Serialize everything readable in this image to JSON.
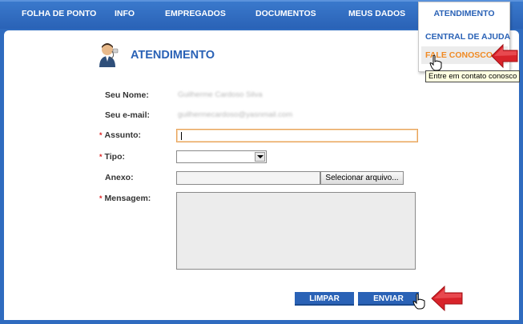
{
  "nav": {
    "items": [
      {
        "label": "FOLHA DE PONTO"
      },
      {
        "label": "INFO"
      },
      {
        "label": "EMPREGADOS"
      },
      {
        "label": "DOCUMENTOS"
      },
      {
        "label": "MEUS DADOS"
      }
    ],
    "active": "ATENDIMENTO"
  },
  "dropdown": {
    "items": [
      {
        "label": "CENTRAL DE AJUDA"
      },
      {
        "label": "FALE CONOSCO"
      }
    ],
    "tooltip": "Entre em contato conosco"
  },
  "page": {
    "title": "ATENDIMENTO"
  },
  "form": {
    "name_label": "Seu Nome:",
    "name_value": "Guilherme Cardoso Silva",
    "email_label": "Seu e-mail:",
    "email_value": "guilhermecardoso@yasnmail.com",
    "required_mark": "*",
    "subject_label": "Assunto:",
    "subject_value": "",
    "type_label": "Tipo:",
    "type_value": "",
    "attachment_label": "Anexo:",
    "file_button_label": "Selecionar arquivo...",
    "message_label": "Mensagem:",
    "message_value": ""
  },
  "buttons": {
    "clear": "LIMPAR",
    "send": "ENVIAR"
  },
  "colors": {
    "primary": "#2a62b6",
    "accent": "#f08a24",
    "required": "#dd2222",
    "arrow": "#d8232a"
  }
}
